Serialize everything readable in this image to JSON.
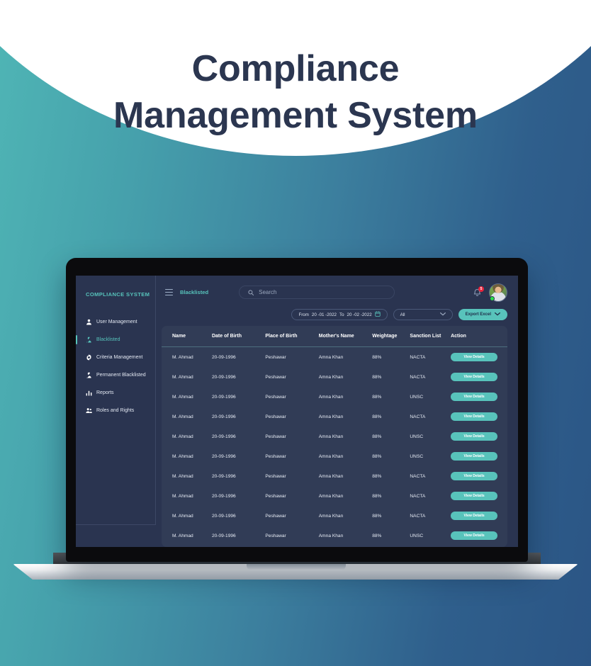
{
  "hero": {
    "title_line1": "Compliance",
    "title_line2": "Management System",
    "title_color": "#2b3650"
  },
  "theme": {
    "accent": "#58c3bb",
    "sidebar_bg": "#2a3450",
    "content_bg": "#2a3450",
    "card_bg": "#313c56",
    "badge_red": "#e8243c",
    "online_green": "#2ae04a"
  },
  "sidebar": {
    "brand": "COMPLIANCE SYSTEM",
    "items": [
      {
        "label": "User Management",
        "icon": "user-icon",
        "active": false
      },
      {
        "label": "Blacklisted",
        "icon": "user-blacklist-icon",
        "active": true
      },
      {
        "label": "Criteria Management",
        "icon": "gear-icon",
        "active": false
      },
      {
        "label": "Permanent Blacklisted",
        "icon": "user-permanent-icon",
        "active": false
      },
      {
        "label": "Reports",
        "icon": "bar-chart-icon",
        "active": false
      },
      {
        "label": "Roles and Rights",
        "icon": "users-icon",
        "active": false
      }
    ]
  },
  "topbar": {
    "menu_icon": "hamburger-icon",
    "page_title": "Blacklisted",
    "search": {
      "placeholder": "Search",
      "value": "",
      "icon": "search-icon"
    },
    "notifications": {
      "icon": "bell-icon",
      "count": "5"
    },
    "avatar": {
      "icon": "avatar",
      "status": "online"
    }
  },
  "filters": {
    "date_range": {
      "from_label": "From",
      "from_value": "20 -01 -2022",
      "to_label": "To",
      "to_value": "20 -02 -2022",
      "icon": "calendar-icon"
    },
    "status_select": {
      "value": "All",
      "icon": "chevron-down-icon"
    },
    "export_button": {
      "label": "Export Excel",
      "icon": "chevron-down-icon"
    }
  },
  "table": {
    "columns": [
      "Name",
      "Date of Birth",
      "Place of Birth",
      "Mother's Name",
      "Weightage",
      "Sanction List",
      "Action"
    ],
    "action_label": "View Details",
    "rows": [
      {
        "name": "M. Ahmad",
        "dob": "20-09-1996",
        "pob": "Peshawar",
        "mother": "Amna Khan",
        "weightage": "88%",
        "sanction": "NACTA"
      },
      {
        "name": "M. Ahmad",
        "dob": "20-09-1996",
        "pob": "Peshawar",
        "mother": "Amna Khan",
        "weightage": "88%",
        "sanction": "NACTA"
      },
      {
        "name": "M. Ahmad",
        "dob": "20-09-1996",
        "pob": "Peshawar",
        "mother": "Amna Khan",
        "weightage": "88%",
        "sanction": "UNSC"
      },
      {
        "name": "M. Ahmad",
        "dob": "20-09-1996",
        "pob": "Peshawar",
        "mother": "Amna Khan",
        "weightage": "88%",
        "sanction": "NACTA"
      },
      {
        "name": "M. Ahmad",
        "dob": "20-09-1996",
        "pob": "Peshawar",
        "mother": "Amna Khan",
        "weightage": "88%",
        "sanction": "UNSC"
      },
      {
        "name": "M. Ahmad",
        "dob": "20-09-1996",
        "pob": "Peshawar",
        "mother": "Amna Khan",
        "weightage": "88%",
        "sanction": "UNSC"
      },
      {
        "name": "M. Ahmad",
        "dob": "20-09-1996",
        "pob": "Peshawar",
        "mother": "Amna Khan",
        "weightage": "88%",
        "sanction": "NACTA"
      },
      {
        "name": "M. Ahmad",
        "dob": "20-09-1996",
        "pob": "Peshawar",
        "mother": "Amna Khan",
        "weightage": "88%",
        "sanction": "NACTA"
      },
      {
        "name": "M. Ahmad",
        "dob": "20-09-1996",
        "pob": "Peshawar",
        "mother": "Amna Khan",
        "weightage": "88%",
        "sanction": "NACTA"
      },
      {
        "name": "M. Ahmad",
        "dob": "20-09-1996",
        "pob": "Peshawar",
        "mother": "Amna Khan",
        "weightage": "88%",
        "sanction": "UNSC"
      }
    ]
  }
}
